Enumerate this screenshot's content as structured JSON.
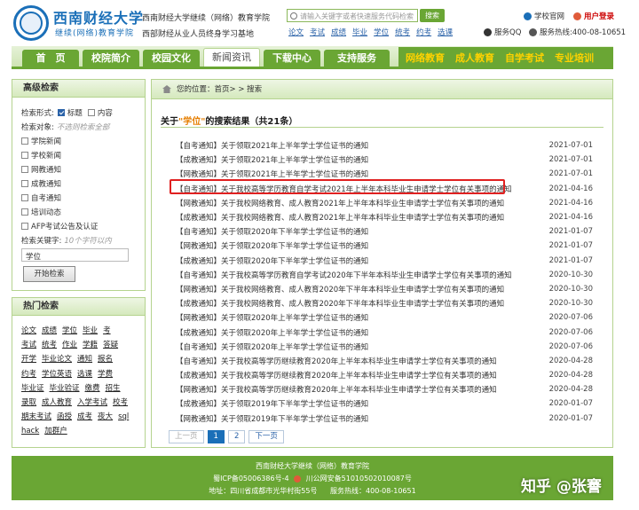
{
  "header": {
    "logo_title": "西南财经大学",
    "logo_subtitle": "继续(网络)教育学院",
    "slogan_1": "西南财经大学继续（网络）教育学院",
    "slogan_2": "西部财经从业人员终身学习基地",
    "search": {
      "placeholder": "请输入关键字或者快速服务代码检索",
      "button": "搜索"
    },
    "hot_words": [
      "论文",
      "考试",
      "成绩",
      "毕业",
      "学位",
      "统考",
      "约考",
      "选课"
    ],
    "home_link": "学校官网",
    "login_link": "用户登录",
    "qq_service": "服务QQ",
    "hotline": "服务热线:400-08-10651"
  },
  "nav": {
    "items": [
      "首　页",
      "校院简介",
      "校园文化",
      "新闻资讯",
      "下载中心",
      "支持服务"
    ],
    "active_index": 3,
    "right_items": [
      "网络教育",
      "成人教育",
      "自学考试",
      "专业培训"
    ]
  },
  "advanced_search": {
    "title": "高级检索",
    "form_label": "检索形式:",
    "form_options": [
      {
        "label": "标题",
        "checked": true
      },
      {
        "label": "内容",
        "checked": false
      }
    ],
    "target_label": "检索对象:",
    "target_hint": "不选则检索全部",
    "targets": [
      "学院新闻",
      "学校新闻",
      "网教通知",
      "成教通知",
      "自考通知",
      "培训动态",
      "AFP考试公告及认证"
    ],
    "keyword_label": "检索关键字:",
    "keyword_hint": "10个字符以内",
    "keyword_value": "学位",
    "submit": "开始检索"
  },
  "hot_search": {
    "title": "热门检索",
    "lines": [
      [
        "论文",
        "成绩",
        "学位",
        "毕业",
        "考"
      ],
      [
        "考试",
        "统考",
        "作业",
        "学籍",
        "答疑"
      ],
      [
        "开学",
        "毕业论文",
        "通知",
        "报名"
      ],
      [
        "约考",
        "学位英语",
        "选课",
        "学费"
      ],
      [
        "毕业证",
        "毕业验证",
        "缴费",
        "招生"
      ],
      [
        "录取",
        "成人教育",
        "入学考试",
        "校考"
      ],
      [
        "期末考试",
        "函授",
        "成考",
        "夜大",
        "sql"
      ],
      [
        "hack",
        "加群户"
      ]
    ]
  },
  "main": {
    "breadcrumb_prefix": "您的位置：",
    "breadcrumb_path": "首页> > 搜索",
    "result_title_pre": "关于",
    "result_query": "\"学位\"",
    "result_title_post": "的搜索结果（共21条）",
    "results": [
      {
        "title": "【自考通知】关于领取2021年上半年学士学位证书的通知",
        "date": "2021-07-01"
      },
      {
        "title": "【成教通知】关于领取2021年上半年学士学位证书的通知",
        "date": "2021-07-01"
      },
      {
        "title": "【网教通知】关于领取2021年上半年学士学位证书的通知",
        "date": "2021-07-01"
      },
      {
        "title": "【自考通知】关于我校高等学历教育自学考试2021年上半年本科毕业生申请学士学位有关事项的通知",
        "date": "2021-04-16"
      },
      {
        "title": "【网教通知】关于我校网络教育、成人教育2021年上半年本科毕业生申请学士学位有关事项的通知",
        "date": "2021-04-16"
      },
      {
        "title": "【成教通知】关于我校网络教育、成人教育2021年上半年本科毕业生申请学士学位有关事项的通知",
        "date": "2021-04-16"
      },
      {
        "title": "【自考通知】关于领取2020年下半年学士学位证书的通知",
        "date": "2021-01-07"
      },
      {
        "title": "【网教通知】关于领取2020年下半年学士学位证书的通知",
        "date": "2021-01-07"
      },
      {
        "title": "【成教通知】关于领取2020年下半年学士学位证书的通知",
        "date": "2021-01-07"
      },
      {
        "title": "【自考通知】关于我校高等学历教育自学考试2020年下半年本科毕业生申请学士学位有关事项的通知",
        "date": "2020-10-30"
      },
      {
        "title": "【网教通知】关于我校网络教育、成人教育2020年下半年本科毕业生申请学士学位有关事项的通知",
        "date": "2020-10-30"
      },
      {
        "title": "【成教通知】关于我校网络教育、成人教育2020年下半年本科毕业生申请学士学位有关事项的通知",
        "date": "2020-10-30"
      },
      {
        "title": "【网教通知】关于领取2020年上半年学士学位证书的通知",
        "date": "2020-07-06"
      },
      {
        "title": "【成教通知】关于领取2020年上半年学士学位证书的通知",
        "date": "2020-07-06"
      },
      {
        "title": "【自考通知】关于领取2020年上半年学士学位证书的通知",
        "date": "2020-07-06"
      },
      {
        "title": "【自考通知】关于我校高等学历继续教育2020年上半年本科毕业生申请学士学位有关事项的通知",
        "date": "2020-04-28"
      },
      {
        "title": "【成教通知】关于我校高等学历继续教育2020年上半年本科毕业生申请学士学位有关事项的通知",
        "date": "2020-04-28"
      },
      {
        "title": "【网教通知】关于我校高等学历继续教育2020年上半年本科毕业生申请学士学位有关事项的通知",
        "date": "2020-04-28"
      },
      {
        "title": "【成教通知】关于领取2019年下半年学士学位证书的通知",
        "date": "2020-01-07"
      },
      {
        "title": "【网教通知】关于领取2019年下半年学士学位证书的通知",
        "date": "2020-01-07"
      }
    ],
    "highlighted_index": 3,
    "pager": {
      "prev": "上一页",
      "pages": [
        "1",
        "2"
      ],
      "current": "1",
      "next": "下一页"
    }
  },
  "footer": {
    "line_1": "西南财经大学继续（网络）教育学院",
    "icp": "蜀ICP备05006386号-4",
    "police": "川公网安备51010502010087号",
    "address": "地址：四川省成都市光华村街55号",
    "phone": "服务热线：400-08-10651"
  },
  "watermark": "知乎 @张謇",
  "colors": {
    "brand_green": "#6aa634",
    "brand_blue": "#1a6fb8",
    "accent_yellow": "#ffd200",
    "highlight_red": "#e02020"
  }
}
